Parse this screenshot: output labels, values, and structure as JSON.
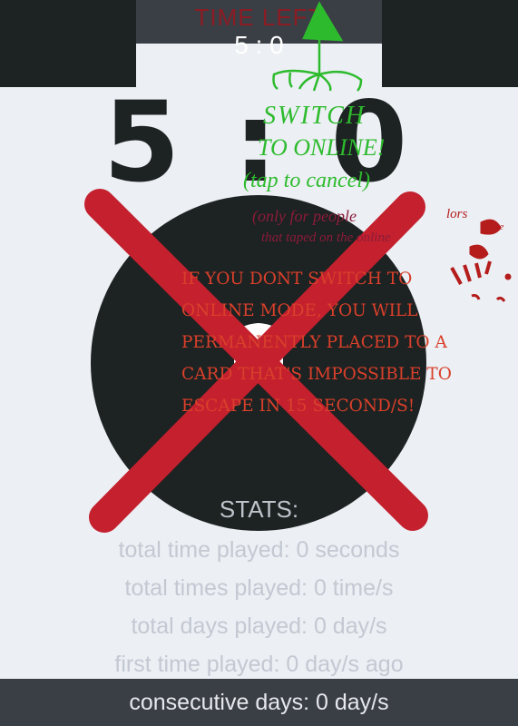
{
  "header": {
    "title": "TIME LEFT",
    "time_small": "5 : 0"
  },
  "timer": {
    "display": "5 : 0"
  },
  "annotations": {
    "green_note": [
      "SWITCH",
      "TO ONLINE!",
      "(tap to cancel)"
    ],
    "maroon_note": [
      "(only for people",
      "that taped on the online"
    ],
    "red_scribble": [
      "lors",
      "bye"
    ]
  },
  "warning_text": "IF YOU DONT SWITCH TO ONLINE MODE, YOU WILL PERMANENTLY PLACED TO A CARD THAT'S IMPOSSIBLE TO ESCAPE IN 15 SECOND/S!",
  "stats": {
    "title": "STATS:",
    "items": [
      "total time played: 0 seconds",
      "total times played: 0 time/s",
      "total days played: 0 day/s",
      "first time played: 0 day/s ago",
      "consecutive days: 0 day/s"
    ]
  },
  "colors": {
    "dark": "#1d2222",
    "bar": "#3a3e45",
    "cross": "#c4202e",
    "green": "#2dbb2d",
    "warning": "#d9402b"
  }
}
